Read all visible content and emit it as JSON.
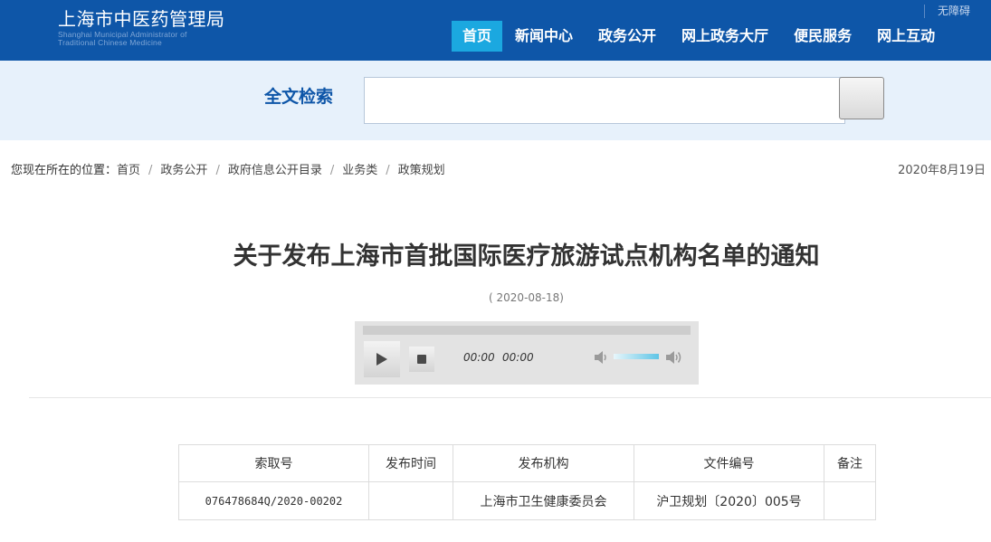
{
  "header": {
    "logo_cn": "上海市中医药管理局",
    "logo_en_line1": "Shanghai Municipal Administrator of",
    "logo_en_line2": "Traditional Chinese Medicine",
    "accessibility": "无障碍",
    "nav": [
      {
        "label": "首页",
        "active": true
      },
      {
        "label": "新闻中心"
      },
      {
        "label": "政务公开"
      },
      {
        "label": "网上政务大厅"
      },
      {
        "label": "便民服务"
      },
      {
        "label": "网上互动"
      }
    ],
    "colors": {
      "primary": "#0e56a8",
      "active": "#1ba8e0",
      "search_band": "#e7f1fb"
    }
  },
  "search": {
    "label": "全文检索",
    "value": "",
    "placeholder": ""
  },
  "breadcrumb": {
    "prefix": "您现在所在的位置：",
    "items": [
      "首页",
      "政务公开",
      "政府信息公开目录",
      "业务类",
      "政策规划"
    ],
    "separator": "/"
  },
  "page_date": "2020年8月19日",
  "article": {
    "title": "关于发布上海市首批国际医疗旅游试点机构名单的通知",
    "date": "( 2020-08-18)"
  },
  "player": {
    "current_time": "00:00",
    "duration": "00:00",
    "progress": 0,
    "volume": 0.8,
    "icons": [
      "play-icon",
      "stop-icon",
      "mute-icon",
      "volume-max-icon"
    ]
  },
  "table": {
    "headers": [
      "索取号",
      "发布时间",
      "发布机构",
      "文件编号",
      "备注"
    ],
    "rows": [
      [
        "076478684Q/2020-00202",
        "",
        "上海市卫生健康委员会",
        "沪卫规划〔2020〕005号",
        ""
      ]
    ]
  }
}
